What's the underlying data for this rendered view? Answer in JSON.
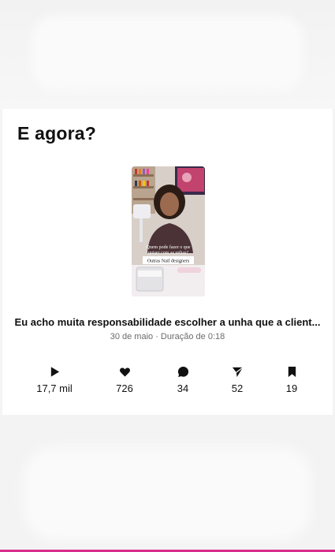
{
  "page": {
    "title": "E agora?"
  },
  "post": {
    "thumbnail_caption_lines": [
      "Quem pode fazer o que",
      "quiser com as unhas?"
    ],
    "thumbnail_tag": "Outras Nail designers",
    "title": "Eu acho muita responsabilidade escolher a unha que a client...",
    "meta": "30 de maio · Duração de 0:18"
  },
  "stats": [
    {
      "icon": "play-icon",
      "value": "17,7 mil"
    },
    {
      "icon": "heart-icon",
      "value": "726"
    },
    {
      "icon": "comment-icon",
      "value": "34"
    },
    {
      "icon": "share-icon",
      "value": "52"
    },
    {
      "icon": "bookmark-icon",
      "value": "19"
    }
  ],
  "colors": {
    "accent": "#d82d8d",
    "text": "#111111",
    "muted": "#6b6b6b"
  }
}
